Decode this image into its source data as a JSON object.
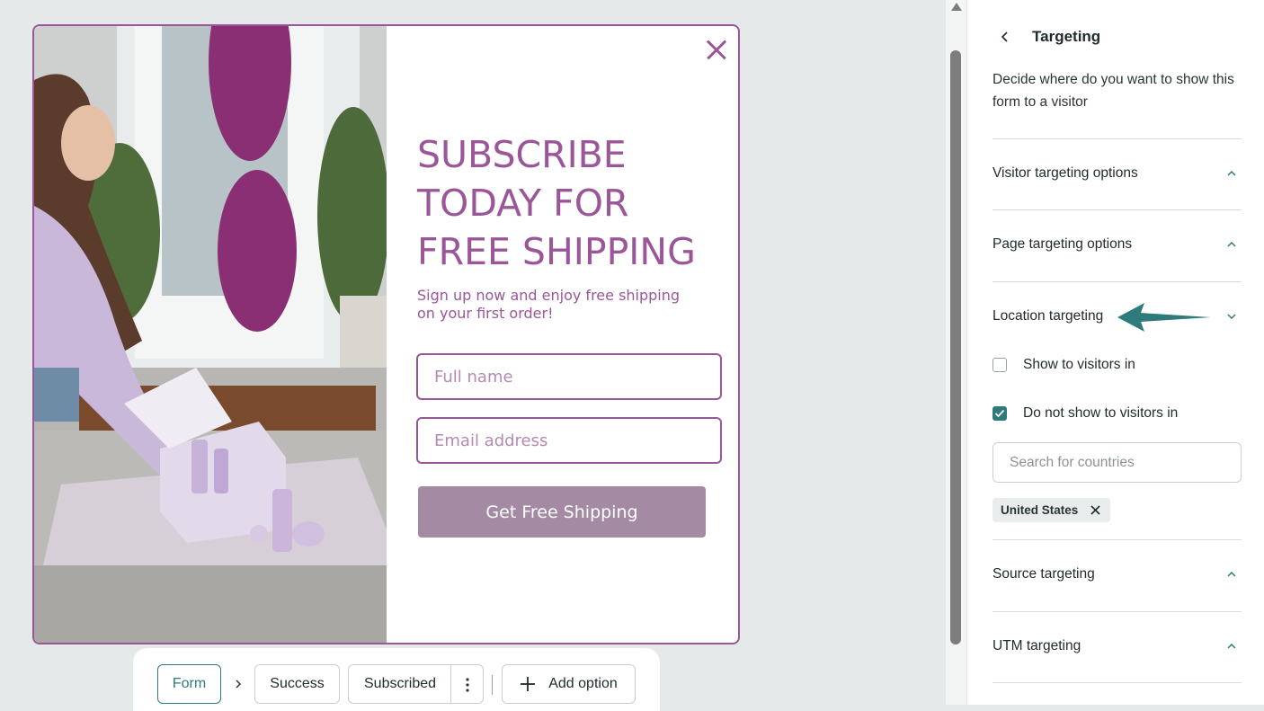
{
  "popup": {
    "headline_lines": [
      "SUBSCRIBE",
      "TODAY FOR",
      "FREE SHIPPING"
    ],
    "subhead_lines": [
      "Sign up now and enjoy free shipping",
      "on your first order!"
    ],
    "name_placeholder": "Full name",
    "email_placeholder": "Email address",
    "cta_label": "Get Free Shipping",
    "accent_color": "#9a5698",
    "button_color": "#a48aa3"
  },
  "steps": {
    "items": [
      "Form",
      "Success",
      "Subscribed"
    ],
    "active": "Form",
    "add_label": "Add option"
  },
  "panel": {
    "title": "Targeting",
    "description": "Decide where do you want to show this form to a visitor",
    "sections": [
      {
        "label": "Visitor targeting options",
        "expanded": false
      },
      {
        "label": "Page targeting options",
        "expanded": false
      },
      {
        "label": "Location targeting",
        "expanded": true
      },
      {
        "label": "Source targeting",
        "expanded": false
      },
      {
        "label": "UTM targeting",
        "expanded": false
      }
    ],
    "location": {
      "options": [
        {
          "label": "Show to visitors in",
          "checked": false
        },
        {
          "label": "Do not show to visitors in",
          "checked": true
        }
      ],
      "search_placeholder": "Search for countries",
      "selected_countries": [
        "United States"
      ]
    },
    "accent_color": "#2d7b7a"
  }
}
